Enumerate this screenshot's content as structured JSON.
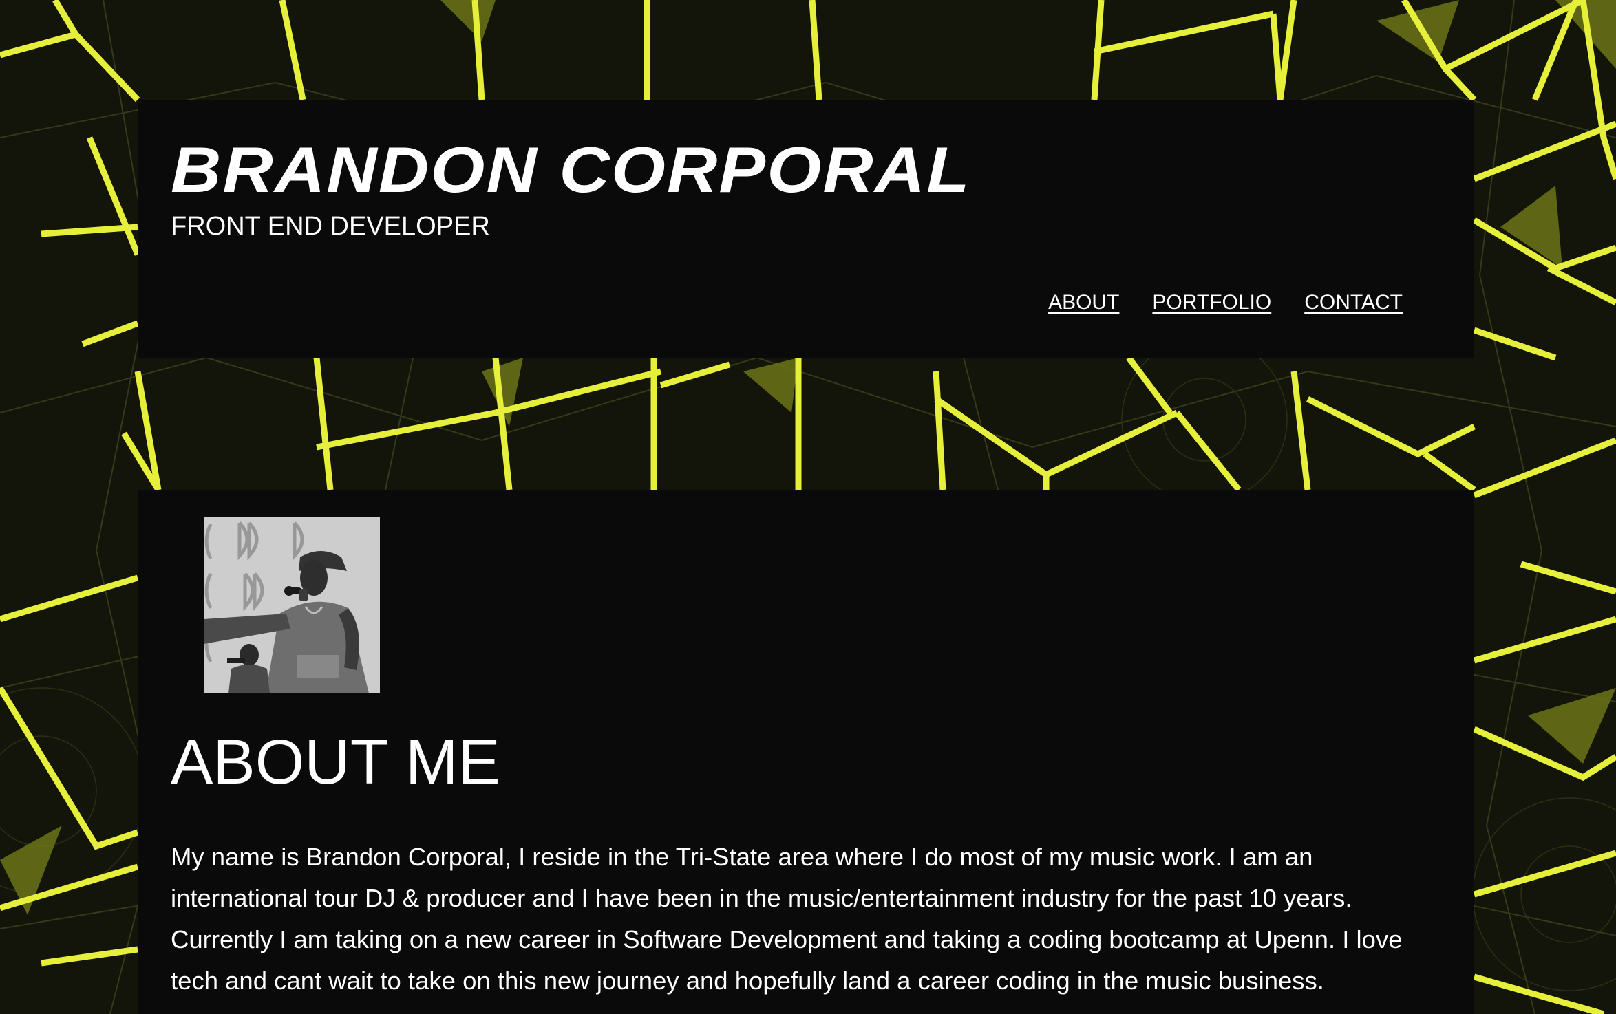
{
  "header": {
    "title": "BRANDON CORPORAL",
    "subtitle": "FRONT END DEVELOPER"
  },
  "nav": {
    "items": [
      {
        "label": "ABOUT"
      },
      {
        "label": "PORTFOLIO"
      },
      {
        "label": "CONTACT"
      }
    ]
  },
  "about": {
    "heading": "ABOUT ME",
    "paragraph": "My name is Brandon Corporal, I reside in the Tri-State area where I do most of my music work. I am an international tour DJ & producer and I have been in the music/entertainment industry for the past 10 years. Currently I am taking on a new career in Software Development and taking a coding bootcamp at Upenn. I love tech and cant wait to take on this new journey and hopefully land a career coding in the music business."
  },
  "colors": {
    "background": "#121408",
    "accent_neon": "#e6f03a",
    "card": "#0a0a0a",
    "text": "#ffffff"
  },
  "icons": {
    "background": "neon-yellow-geometric-cube-pattern",
    "profile": "profile-photo-grayscale-dj-with-microphone"
  }
}
